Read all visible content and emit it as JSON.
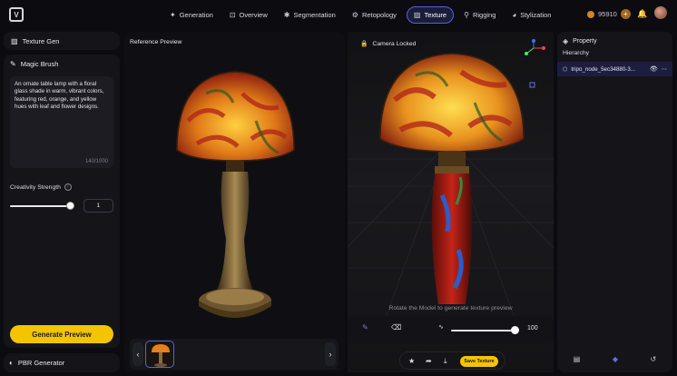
{
  "nav": {
    "tabs": [
      {
        "label": "Generation",
        "icon": "sparkle-icon",
        "active": false
      },
      {
        "label": "Overview",
        "icon": "overview-icon",
        "active": false
      },
      {
        "label": "Segmentation",
        "icon": "segment-icon",
        "active": false
      },
      {
        "label": "Retopology",
        "icon": "retopo-icon",
        "active": false
      },
      {
        "label": "Texture",
        "icon": "texture-icon",
        "active": true
      },
      {
        "label": "Rigging",
        "icon": "rig-icon",
        "active": false
      },
      {
        "label": "Stylization",
        "icon": "palette-icon",
        "active": false
      }
    ],
    "credits": "95910"
  },
  "left": {
    "texture_gen_title": "Texture Gen",
    "magic_brush_title": "Magic Brush",
    "prompt": "An ornate table lamp with a floral glass shade in warm, vibrant colors, featuring red, orange, and yellow hues with leaf and flower designs.",
    "counter": "140/1000",
    "creativity_label": "Creativity Strength",
    "creativity_value": "1",
    "generate_button": "Generate Preview",
    "pbr_title": "PBR Generator"
  },
  "reference": {
    "title": "Reference Preview",
    "prev_arrow": "‹",
    "next_arrow": "›"
  },
  "viewport": {
    "camera_label": "Camera Locked",
    "hint": "Rotate the Model to generate texture preview",
    "brush_value": "100",
    "save_button": "Save Texture"
  },
  "right": {
    "property_title": "Property",
    "hierarchy_label": "Hierarchy",
    "node_name": "tripo_node_5ec34880-3..."
  },
  "colors": {
    "accent": "#f5c400",
    "active_tab": "#5a5fe0"
  }
}
